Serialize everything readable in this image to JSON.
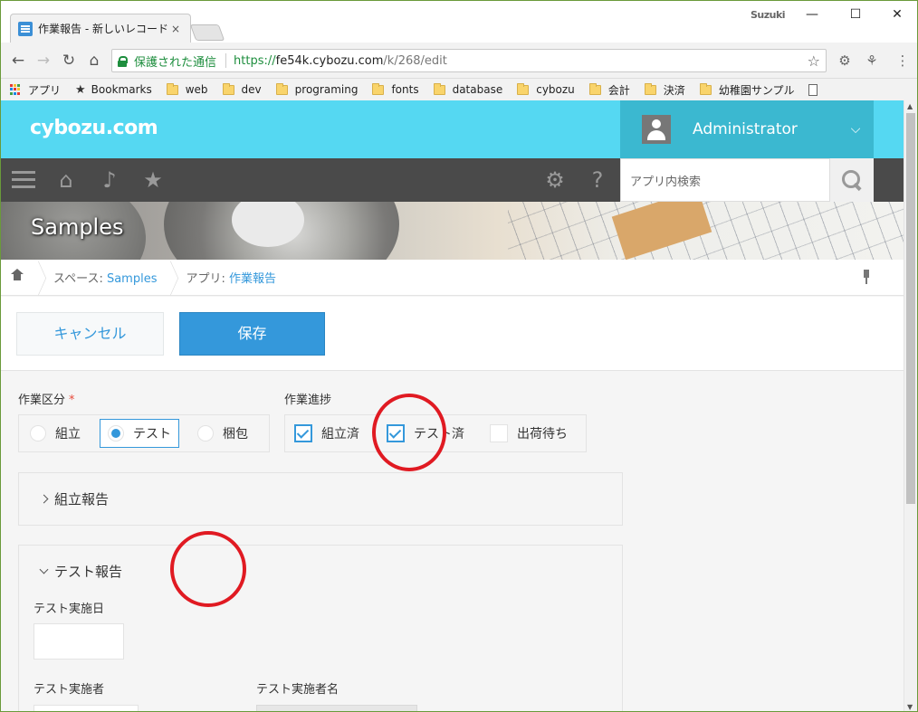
{
  "browser": {
    "tab_title": "作業報告 - 新しいレコード",
    "tab_close": "×",
    "user_label": "Suzuki",
    "win_min": "—",
    "win_max": "☐",
    "win_close": "✕",
    "secure_label": "保護された通信",
    "url_scheme": "https://",
    "url_host": "fe54k.cybozu.com",
    "url_path": "/k/268/edit",
    "bookmarks": {
      "apps": "アプリ",
      "bookmarks": "Bookmarks",
      "folders": [
        "web",
        "dev",
        "programing",
        "fonts",
        "database",
        "cybozu",
        "会計",
        "決済",
        "幼稚園サンプル"
      ]
    }
  },
  "app": {
    "logo": "cybozu.com",
    "user_name": "Administrator",
    "search_placeholder": "アプリ内検索",
    "space_title": "Samples",
    "breadcrumb": {
      "space_prefix": "スペース: ",
      "space_name": "Samples",
      "app_prefix": "アプリ: ",
      "app_name": "作業報告"
    },
    "cancel_label": "キャンセル",
    "save_label": "保存"
  },
  "form": {
    "work_type": {
      "label": "作業区分",
      "required_mark": "*",
      "options": [
        "組立",
        "テスト",
        "梱包"
      ],
      "selected": "テスト"
    },
    "progress": {
      "label": "作業進捗",
      "options": [
        "組立済",
        "テスト済",
        "出荷待ち"
      ],
      "checked": [
        "組立済",
        "テスト済"
      ]
    },
    "sections": {
      "assembly": "組立報告",
      "test": "テスト報告"
    },
    "test_date_label": "テスト実施日",
    "tester_label": "テスト実施者",
    "tester_name_label": "テスト実施者名"
  },
  "colors": {
    "header": "#55d8f2",
    "accent": "#3498db",
    "annotation": "#e01a22"
  }
}
